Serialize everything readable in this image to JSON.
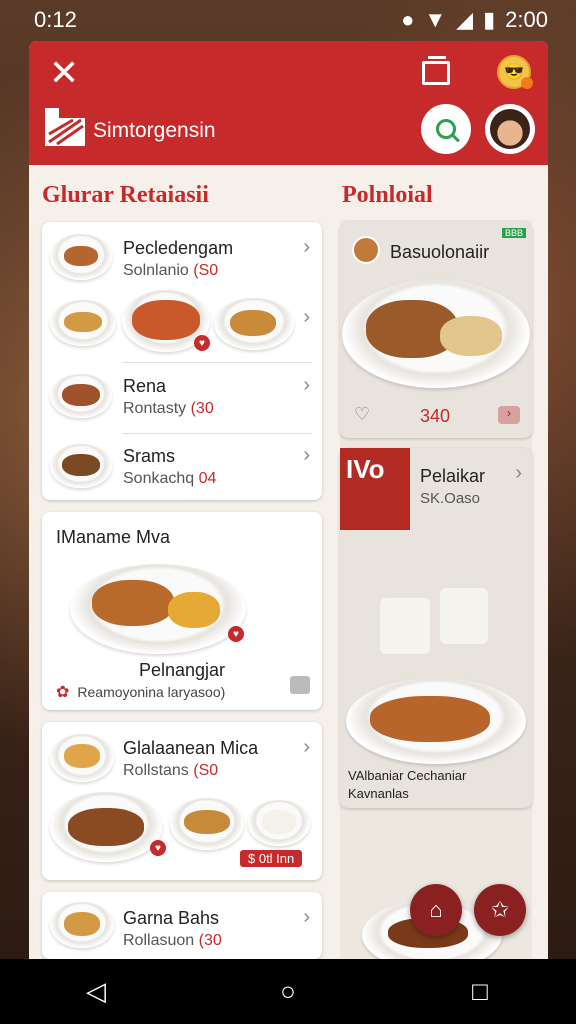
{
  "status_bar": {
    "time_left": "0:12",
    "time_right": "2:00"
  },
  "header": {
    "brand": "Simtorgensin"
  },
  "left_section": {
    "title": "Glurar Retaiasii"
  },
  "right_section": {
    "title": "Polnloial"
  },
  "menu_card_1": {
    "items": [
      {
        "name": "Pecledengam",
        "sub_text": "Solnlanio ",
        "sub_price": "(S0"
      },
      {
        "name": "Rena",
        "sub_text": "Rontasty ",
        "sub_price": "(30"
      },
      {
        "name": "Srams",
        "sub_text": "Sonkachq ",
        "sub_price": "04"
      }
    ]
  },
  "feature_card": {
    "title": "IManame Mva",
    "dish_name": "Pelnangjar",
    "caption": "Reamoyonina laryasoo)"
  },
  "menu_card_2": {
    "name": "Glalaanean Mica",
    "sub_text": "Rollstans ",
    "sub_price": "(S0",
    "tag": "$ 0tl Inn"
  },
  "menu_card_3": {
    "name": "Garna Bahs",
    "sub_text": "Rollasuon ",
    "sub_price": "(30"
  },
  "right_card_1": {
    "title": "Basuolonaiir",
    "tag": "BBB",
    "price": "340"
  },
  "right_card_2": {
    "logo_text": "IVo",
    "name": "Pelaikar",
    "sub": "SK.Oaso",
    "caption_line1": "VAlbaniar Cechaniar",
    "caption_line2": "Kavnanlas"
  },
  "colors": {
    "brand_red": "#c72a2a",
    "accent_green": "#2aa14a",
    "fab": "#8b2020"
  },
  "icons": {
    "close": "close-icon",
    "screen": "cast-icon",
    "sun": "sun-emoji-icon",
    "search": "search-icon",
    "home": "home-icon",
    "star": "star-icon"
  }
}
